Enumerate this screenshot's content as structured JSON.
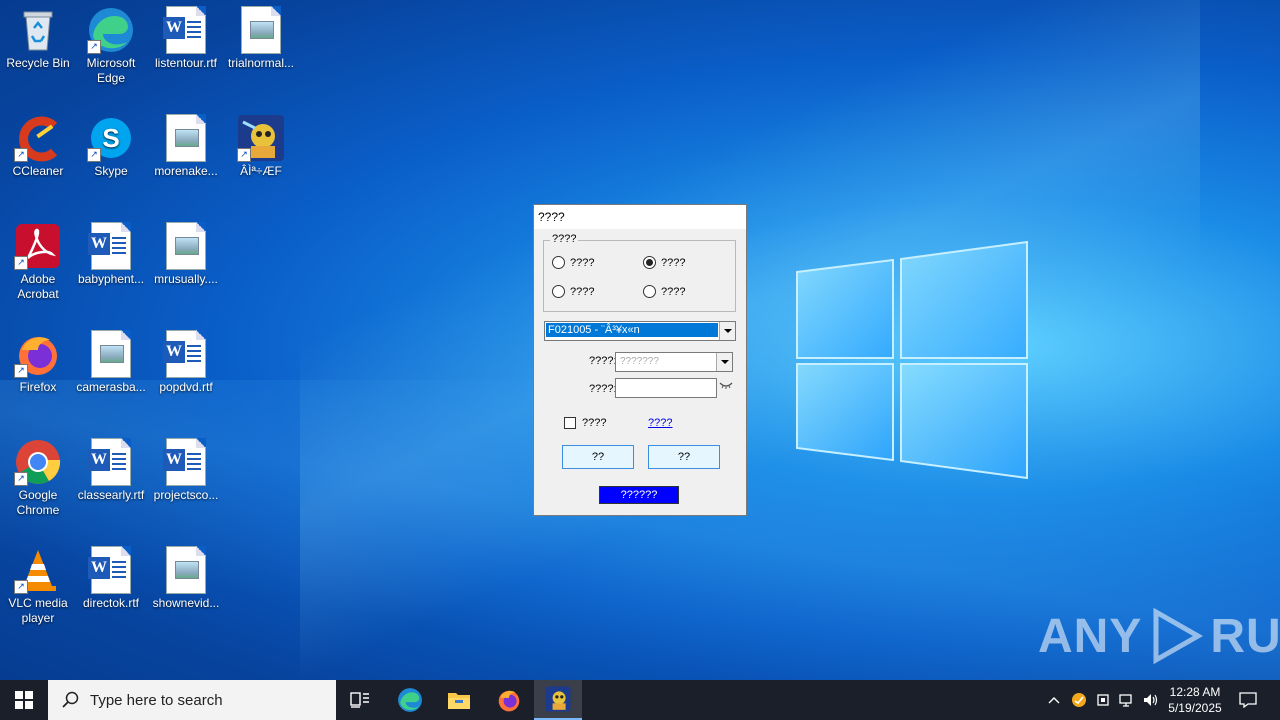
{
  "desktop": {
    "icons": [
      {
        "label": "Recycle Bin"
      },
      {
        "label": "Microsoft Edge"
      },
      {
        "label": "listentour.rtf"
      },
      {
        "label": "trialnormal..."
      },
      {
        "label": "CCleaner"
      },
      {
        "label": "Skype"
      },
      {
        "label": "morenake..."
      },
      {
        "label": "ÂÌª÷ÆF"
      },
      {
        "label": "Adobe Acrobat"
      },
      {
        "label": "babyphent..."
      },
      {
        "label": "mrusually...."
      },
      {
        "label": "Firefox"
      },
      {
        "label": "camerasba..."
      },
      {
        "label": "popdvd.rtf"
      },
      {
        "label": "Google Chrome"
      },
      {
        "label": "classearly.rtf"
      },
      {
        "label": "projectsco..."
      },
      {
        "label": "VLC media player"
      },
      {
        "label": "directok.rtf"
      },
      {
        "label": "shownevid..."
      }
    ]
  },
  "dialog": {
    "title": "????",
    "group_label": "????",
    "radios": [
      {
        "label": "????",
        "checked": false
      },
      {
        "label": "????",
        "checked": true
      },
      {
        "label": "????",
        "checked": false
      },
      {
        "label": "????",
        "checked": false
      }
    ],
    "server_select": "F021005 - ¨Â³¥x«n",
    "field1_label": "????:",
    "field1_placeholder": "???????",
    "field2_label": "????:",
    "field2_value": "",
    "remember_label": "????",
    "remember_checked": false,
    "link_label": "????",
    "button1_label": "??",
    "button2_label": "??",
    "status_label": "??????"
  },
  "taskbar": {
    "search_placeholder": "Type here to search",
    "time": "12:28 AM",
    "date": "5/19/2025"
  },
  "watermark": {
    "text_left": "ANY",
    "text_right": "RUN"
  },
  "colors": {
    "accent": "#0078d7",
    "taskbar": "#1b1f2a",
    "status_bg": "#0000ff"
  }
}
